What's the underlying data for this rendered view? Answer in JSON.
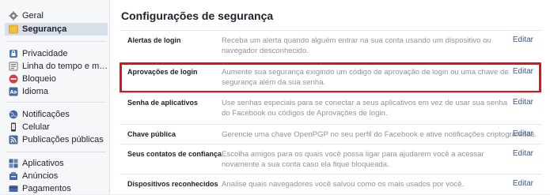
{
  "sidebar": {
    "groups": [
      [
        {
          "label": "Geral",
          "icon": "gear-icon"
        },
        {
          "label": "Segurança",
          "icon": "shield-icon",
          "active": true
        }
      ],
      [
        {
          "label": "Privacidade",
          "icon": "lock-icon"
        },
        {
          "label": "Linha do tempo e marc…",
          "icon": "timeline-icon"
        },
        {
          "label": "Bloqueio",
          "icon": "block-icon"
        },
        {
          "label": "Idioma",
          "icon": "language-icon"
        }
      ],
      [
        {
          "label": "Notificações",
          "icon": "globe-icon"
        },
        {
          "label": "Celular",
          "icon": "mobile-icon"
        },
        {
          "label": "Publicações públicas",
          "icon": "rss-icon"
        }
      ],
      [
        {
          "label": "Aplicativos",
          "icon": "apps-icon"
        },
        {
          "label": "Anúncios",
          "icon": "ads-icon"
        },
        {
          "label": "Pagamentos",
          "icon": "payments-icon"
        }
      ]
    ]
  },
  "main": {
    "title": "Configurações de segurança",
    "edit_label": "Editar",
    "rows": [
      {
        "label": "Alertas de login",
        "desc": "Receba um alerta quando alguém entrar na sua conta usando um dispositivo ou navegador desconhecido."
      },
      {
        "label": "Aprovações de login",
        "desc": "Aumente sua segurança exigindo um código de aprovação de login ou uma chave de segurança além da sua senha.",
        "highlighted": true
      },
      {
        "label": "Senha de aplicativos",
        "desc": "Use senhas especiais para se conectar a seus aplicativos em vez de usar sua senha do Facebook ou códigos de Aprovações de login."
      },
      {
        "label": "Chave pública",
        "desc": "Gerencie uma chave OpenPGP no seu perfil do Facebook e ative notificações criptografadas."
      },
      {
        "label": "Seus contatos de confiança",
        "desc": "Escolha amigos para os quais você possa ligar para ajudarem você a acessar novamente a sua conta caso ela fique bloqueada."
      },
      {
        "label": "Dispositivos reconhecidos",
        "desc": "Analise quais navegadores você salvou como os mais usados por você."
      }
    ]
  },
  "colors": {
    "link": "#365899",
    "highlight_border": "#e0111a",
    "active_item_bg": "#d8dfea"
  }
}
